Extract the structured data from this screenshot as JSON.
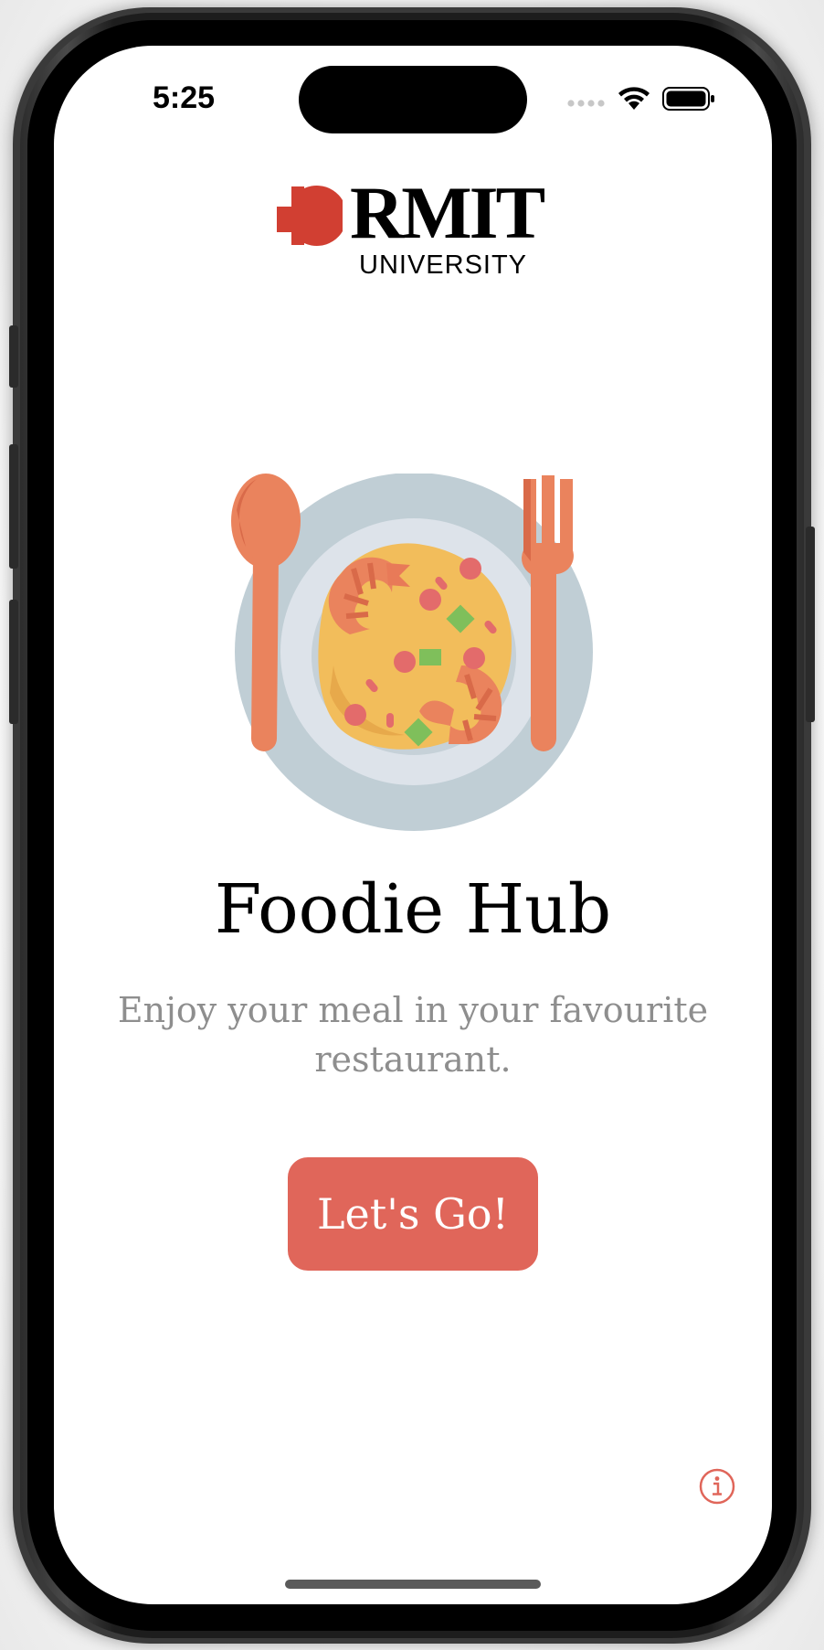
{
  "status_bar": {
    "time": "5:25",
    "icons": [
      "cellular-signal-icon",
      "wifi-icon",
      "battery-icon"
    ]
  },
  "logo": {
    "name": "RMIT",
    "subtitle": "UNIVERSITY",
    "brand_color": "#d13f32"
  },
  "hero": {
    "illustration": "plate-with-paella-spoon-fork-icon"
  },
  "title": "Foodie Hub",
  "subtitle": "Enjoy your meal in your favourite restaurant.",
  "cta": {
    "label": "Let's Go!",
    "color": "#e0665a"
  },
  "info_button": {
    "icon": "info-icon",
    "color": "#e0665a"
  }
}
